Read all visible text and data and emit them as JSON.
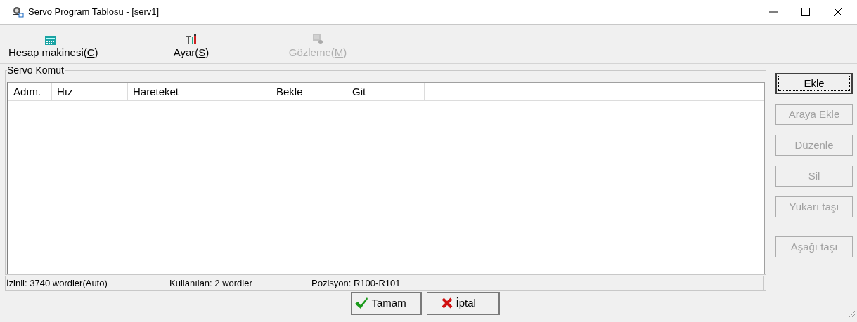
{
  "window": {
    "title": "Servo Program Tablosu - [serv1]"
  },
  "toolbar": [
    {
      "label": "Hesap makinesi(C)",
      "kind": "calculator",
      "disabled": false
    },
    {
      "label": "Ayar(S)",
      "kind": "tools",
      "disabled": false
    },
    {
      "label": "Gözleme(M)",
      "kind": "monitor",
      "disabled": true
    }
  ],
  "group": {
    "title": "Servo Komut"
  },
  "table": {
    "columns": [
      "Adım.",
      "Hız",
      "Hareteket",
      "Bekle",
      "Git"
    ]
  },
  "side_buttons": [
    {
      "label": "Ekle",
      "disabled": false,
      "focused": true
    },
    {
      "label": "Araya Ekle",
      "disabled": true,
      "focused": false
    },
    {
      "label": "Düzenle",
      "disabled": true,
      "focused": false
    },
    {
      "label": "Sil",
      "disabled": true,
      "focused": false
    },
    {
      "label": "Yukarı taşı",
      "disabled": true,
      "focused": false
    },
    {
      "label": "Aşağı taşı",
      "disabled": true,
      "focused": false
    }
  ],
  "status_bar": [
    "İzinli: 3740 wordler(Auto)",
    "Kullanılan: 2 wordler",
    "Pozisyon: R100-R101"
  ],
  "buttons": [
    {
      "label": "Tamam",
      "kind": "ok"
    },
    {
      "label": "İptal",
      "kind": "cancel"
    }
  ]
}
